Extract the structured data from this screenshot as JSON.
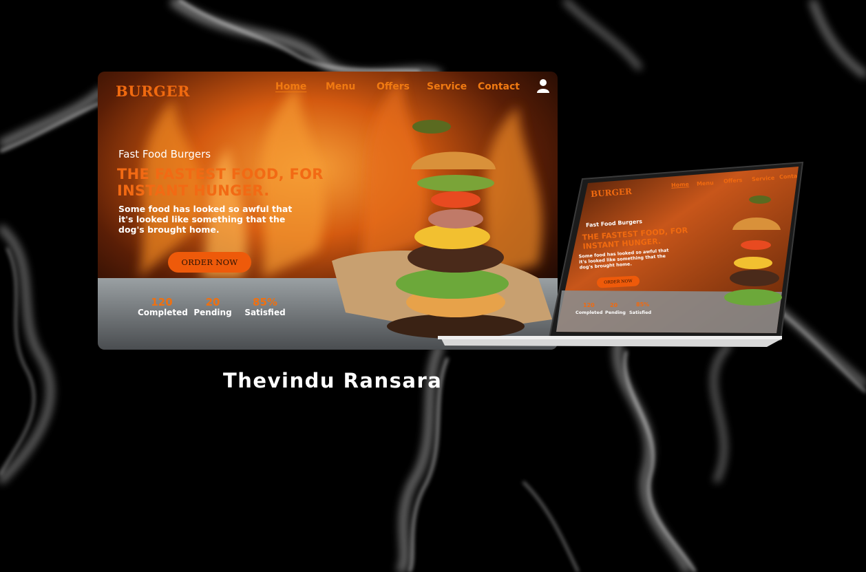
{
  "author": "Thevindu Ransara",
  "brand": "BURGER",
  "nav": {
    "items": [
      "Home",
      "Menu",
      "Offers",
      "Service",
      "Contact"
    ],
    "active": "Home"
  },
  "hero": {
    "kicker": "Fast Food Burgers",
    "title": "THE FASTEST FOOD, FOR INSTANT HUNGER.",
    "description": "Some food has looked so awful that it's looked like something that the dog's brought home.",
    "cta": "ORDER NOW"
  },
  "stats": [
    {
      "value": "120",
      "label": "Completed"
    },
    {
      "value": "20",
      "label": "Pending"
    },
    {
      "value": "85%",
      "label": "Satisfied"
    }
  ],
  "laptop_nav_items": [
    "Home",
    "Menu",
    "Offers",
    "Service",
    "Conta"
  ],
  "icons": [
    "user-icon"
  ],
  "colors": {
    "accent": "#f06a10",
    "background": "#000000",
    "button": "#ee5a0a"
  }
}
